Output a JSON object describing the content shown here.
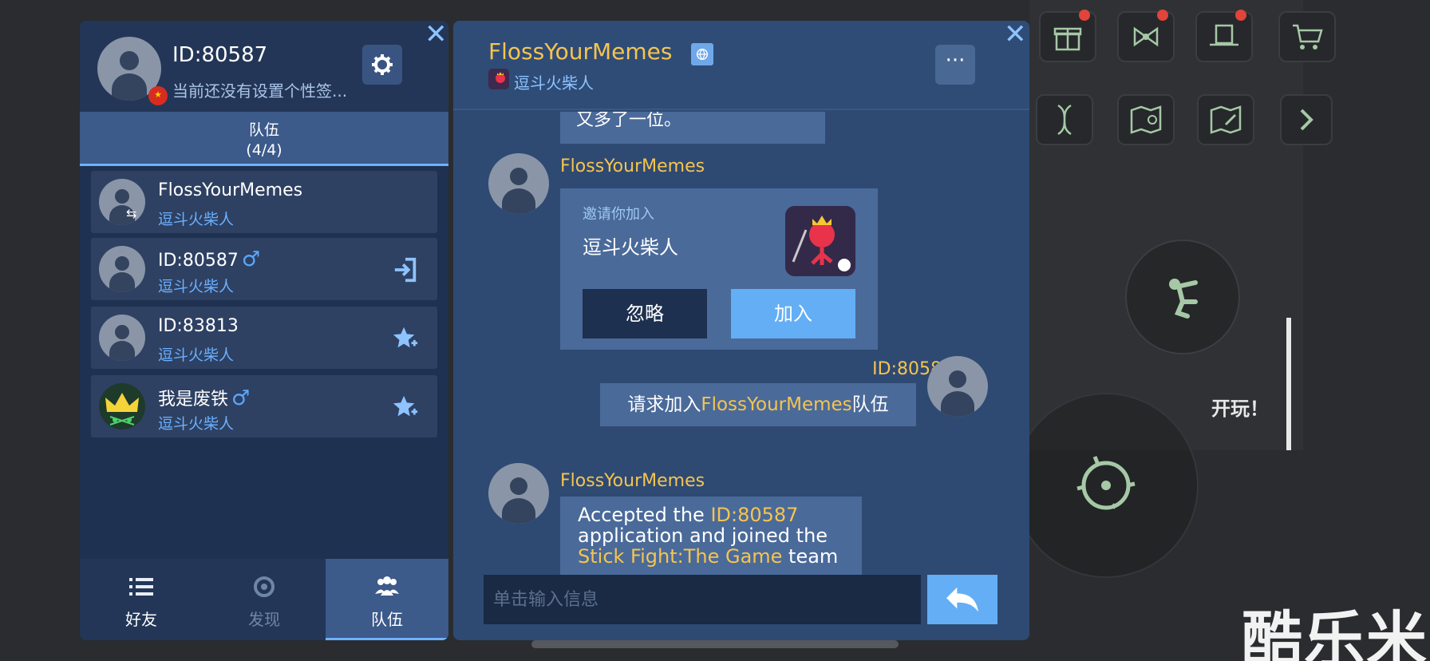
{
  "profile": {
    "id_label": "ID:80587",
    "signature": "当前还没有设置个性签...",
    "flag": "★"
  },
  "team_tab": {
    "label": "队伍",
    "count": "(4/4)"
  },
  "members": [
    {
      "name": "FlossYourMemes",
      "game": "逗斗火柴人",
      "gender": "",
      "action_icon": "swap-icon"
    },
    {
      "name": "ID:80587",
      "game": "逗斗火柴人",
      "gender": "♂",
      "action_icon": "enter-icon"
    },
    {
      "name": "ID:83813",
      "game": "逗斗火柴人",
      "gender": "",
      "action_icon": "star-plus-icon"
    },
    {
      "name": "我是废铁",
      "game": "逗斗火柴人",
      "gender": "♂",
      "action_icon": "star-plus-icon"
    }
  ],
  "nav": [
    {
      "label": "好友",
      "icon": "list-icon"
    },
    {
      "label": "发现",
      "icon": "discover-icon"
    },
    {
      "label": "队伍",
      "icon": "team-icon"
    }
  ],
  "chat": {
    "title": "FlossYourMemes",
    "subtitle": "逗斗火柴人",
    "top_partial": "又多了一位。",
    "msg1_sender": "FlossYourMemes",
    "invite": {
      "label": "邀请你加入",
      "game": "逗斗火柴人",
      "ignore": "忽略",
      "join": "加入"
    },
    "msg2_sender": "ID:80587",
    "msg2_prefix": "请求加入",
    "msg2_highlight": "FlossYourMemes",
    "msg2_suffix": "队伍",
    "msg3_sender": "FlossYourMemes",
    "msg3_p1": "Accepted the ",
    "msg3_h1": "ID:80587",
    "msg3_p2": "application and joined the",
    "msg3_h2": "Stick Fight:The Game",
    "msg3_p3": " team",
    "input_placeholder": "单击输入信息"
  },
  "game_ui": {
    "start_label": "开玩！",
    "watermark": "酷乐米"
  },
  "colors": {
    "accent_gold": "#f6c44f",
    "accent_blue": "#64aef5",
    "panel_bg": "#1f3150"
  }
}
